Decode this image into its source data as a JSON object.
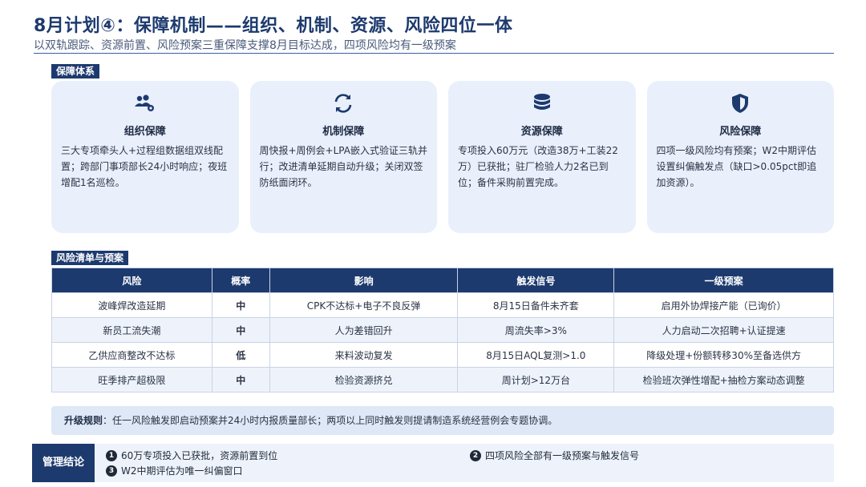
{
  "header": {
    "title": "8月计划④：保障机制——组织、机制、资源、风险四位一体",
    "subtitle": "以双轨跟踪、资源前置、风险预案三重保障支撑8月目标达成，四项风险均有一级预案"
  },
  "section1": {
    "label": "保障体系"
  },
  "cards": [
    {
      "icon": "people-gear-icon",
      "title": "组织保障",
      "body": "三大专项牵头人+过程组数据组双线配置；跨部门事项部长24小时响应；夜班增配1名巡检。"
    },
    {
      "icon": "sync-arrows-icon",
      "title": "机制保障",
      "body": "周快报+周例会+LPA嵌入式验证三轨并行；改进清单延期自动升级；关闭双签防纸面闭环。"
    },
    {
      "icon": "coins-icon",
      "title": "资源保障",
      "body": "专项投入60万元（改造38万+工装22万）已获批；驻厂检验人力2名已到位；备件采购前置完成。"
    },
    {
      "icon": "shield-icon",
      "title": "风险保障",
      "body": "四项一级风险均有预案；W2中期评估设置纠偏触发点（缺口>0.05pct即追加资源）。"
    }
  ],
  "section2": {
    "label": "风险清单与预案"
  },
  "table": {
    "headers": [
      "风险",
      "概率",
      "影响",
      "触发信号",
      "一级预案"
    ],
    "rows": [
      [
        "波峰焊改造延期",
        "中",
        "CPK不达标+电子不良反弹",
        "8月15日备件未齐套",
        "启用外协焊接产能（已询价）"
      ],
      [
        "新员工流失潮",
        "中",
        "人为差错回升",
        "周流失率>3%",
        "人力启动二次招聘+认证提速"
      ],
      [
        "乙供应商整改不达标",
        "低",
        "来料波动复发",
        "8月15日AQL复测>1.0",
        "降级处理+份额转移30%至备选供方"
      ],
      [
        "旺季排产超极限",
        "中",
        "检验资源挤兑",
        "周计划>12万台",
        "检验班次弹性增配+抽检方案动态调整"
      ]
    ]
  },
  "rule": {
    "label": "升级规则",
    "text": "：任一风险触发即启动预案并24小时内报质量部长；两项以上同时触发则提请制造系统经营例会专题协调。"
  },
  "conclusion": {
    "label": "管理结论",
    "items": [
      {
        "num": "1",
        "text": "60万专项投入已获批，资源前置到位"
      },
      {
        "num": "2",
        "text": "四项风险全部有一级预案与触发信号"
      },
      {
        "num": "3",
        "text": "W2中期评估为唯一纠偏窗口"
      }
    ]
  },
  "colors": {
    "primary": "#1d3a6e",
    "card_bg": "#e9f0fb",
    "mid_probability": "#e07a1f",
    "low_probability": "#3f8f3a"
  }
}
